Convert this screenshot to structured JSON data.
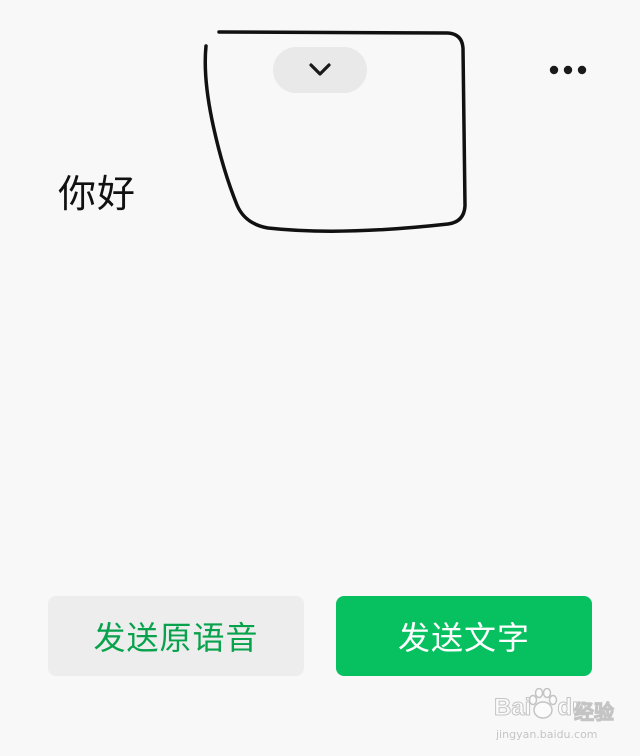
{
  "header": {
    "collapse_icon": "chevron-down-icon",
    "more_icon": "more-horizontal-icon"
  },
  "content": {
    "recognized_text": "你好"
  },
  "actions": {
    "send_voice_label": "发送原语音",
    "send_text_label": "发送文字"
  },
  "watermark": {
    "brand": "Bai",
    "brand_suffix": "du",
    "product": "经验",
    "url": "jingyan.baidu.com"
  },
  "colors": {
    "background": "#f8f8f8",
    "accent_green": "#07c160",
    "voice_button_text": "#07a24b",
    "voice_button_bg": "#ededed"
  }
}
